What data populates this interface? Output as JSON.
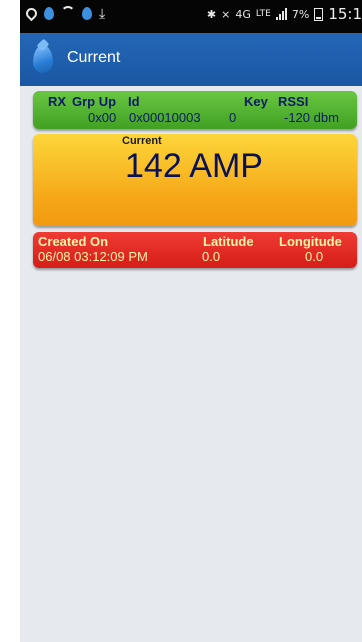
{
  "status_bar": {
    "network": "4G",
    "lte": "LTE",
    "battery": "7%",
    "time": "15:1"
  },
  "app_bar": {
    "title": "Current"
  },
  "device_card": {
    "headers": [
      "RX",
      "Grp Up",
      "Id",
      "Key",
      "RSSI"
    ],
    "values": {
      "grp_up": "0x00",
      "id": "0x00010003",
      "key": "0",
      "rssi": "-120 dbm"
    }
  },
  "current_card": {
    "label": "Current",
    "value": "142 AMP"
  },
  "location_card": {
    "headers": [
      "Created On",
      "Latitude",
      "Longitude"
    ],
    "values": {
      "created_on": "06/08 03:12:09 PM",
      "latitude": "0.0",
      "longitude": "0.0"
    }
  },
  "colors": {
    "app_bar": "#1f5fad",
    "green_card": "#4fae2c",
    "orange_card": "#f6a718",
    "red_card": "#e02a24",
    "background": "#e6e9ee"
  }
}
